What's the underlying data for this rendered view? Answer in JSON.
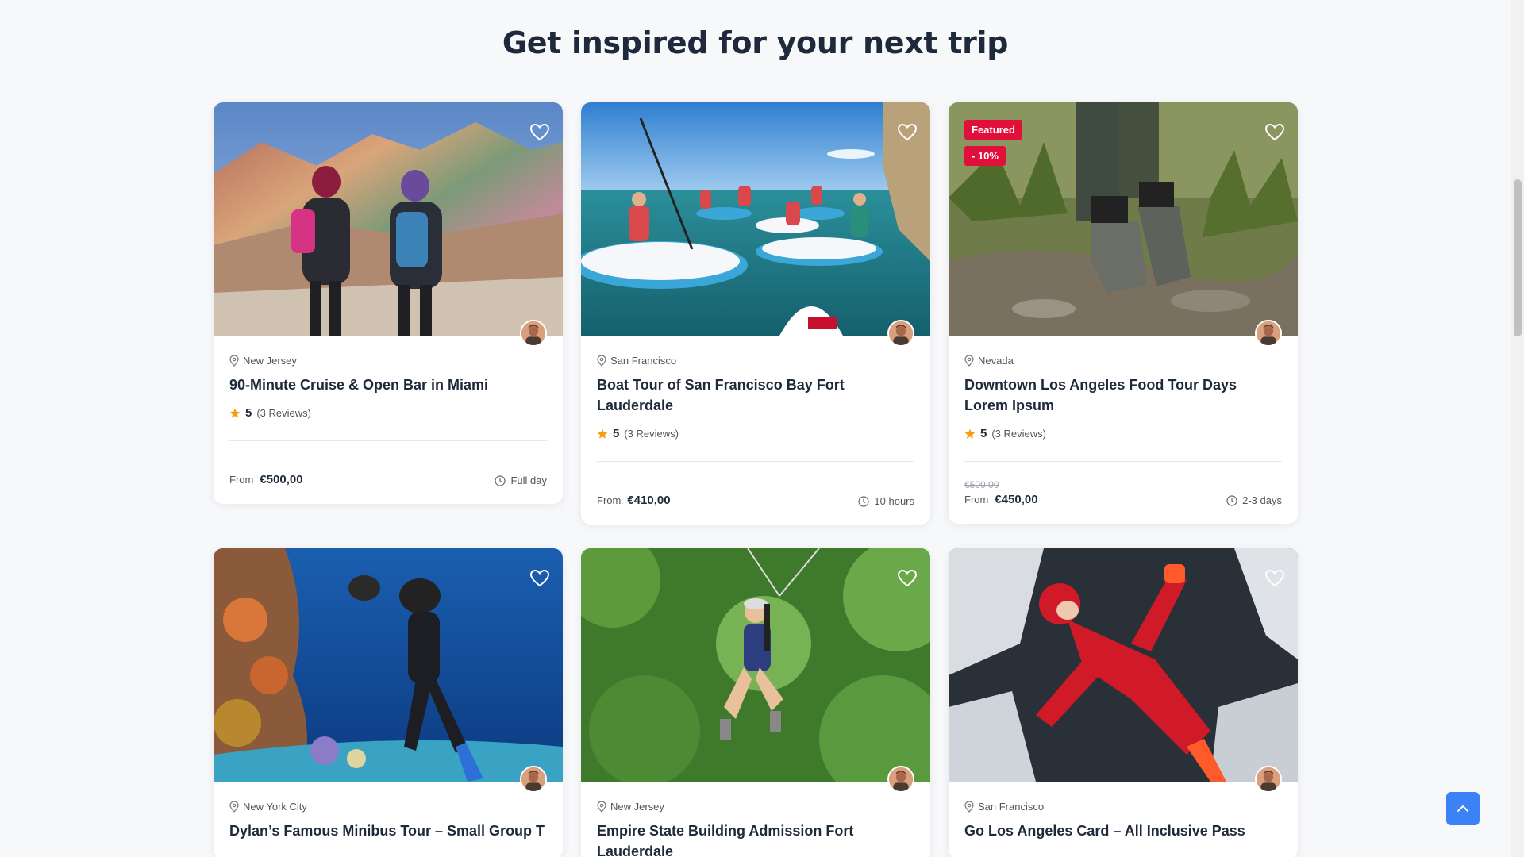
{
  "section": {
    "title": "Get inspired for your next trip"
  },
  "colors": {
    "accent": "#e0103a",
    "star": "#f59e0b",
    "primary": "#3b82f6"
  },
  "cards": [
    {
      "location": "New Jersey",
      "title": "90-Minute Cruise & Open Bar in Miami",
      "rating": "5",
      "reviews": "(3 Reviews)",
      "price_prefix": "From",
      "price": "€500,00",
      "duration": "Full day"
    },
    {
      "location": "San Francisco",
      "title": "Boat Tour of San Francisco Bay Fort Lauderdale",
      "rating": "5",
      "reviews": "(3 Reviews)",
      "price_prefix": "From",
      "price": "€410,00",
      "duration": "10 hours"
    },
    {
      "location": "Nevada",
      "title": "Downtown Los Angeles Food Tour Days Lorem Ipsum",
      "rating": "5",
      "reviews": "(3 Reviews)",
      "badge_featured": "Featured",
      "badge_discount": "- 10%",
      "old_price": "€500,00",
      "price_prefix": "From",
      "price": "€450,00",
      "duration": "2-3 days"
    },
    {
      "location": "New York City",
      "title": "Dylan’s Famous Minibus Tour – Small Group T"
    },
    {
      "location": "New Jersey",
      "title": "Empire State Building Admission Fort Lauderdale"
    },
    {
      "location": "San Francisco",
      "title": "Go Los Angeles Card – All Inclusive Pass"
    }
  ]
}
